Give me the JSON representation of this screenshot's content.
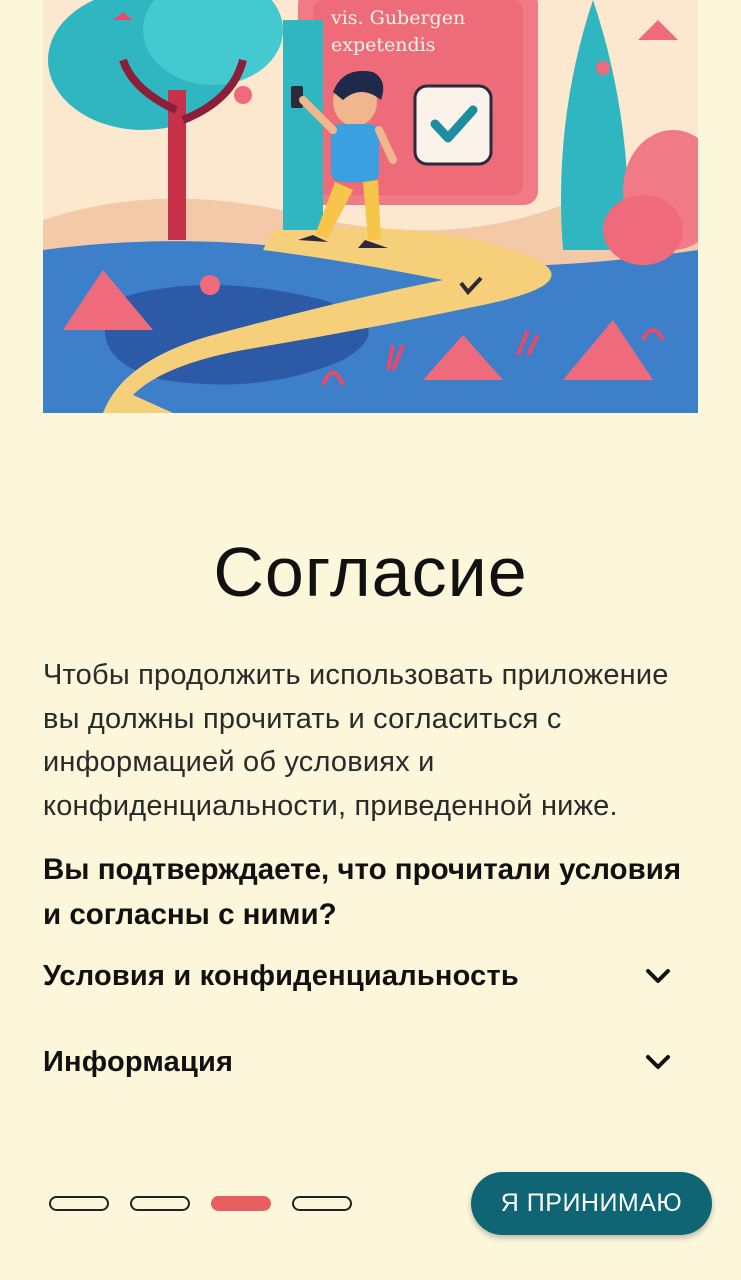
{
  "hero": {
    "sign_line1": "vis. Gubergen",
    "sign_line2": "expetendis"
  },
  "title": "Согласие",
  "description": "Чтобы продолжить использовать приложение вы должны прочитать и согласиться с информацией об условиях и конфиденциальности, приведенной ниже.",
  "question": "Вы подтверждаете, что прочитали условия и согласны с ними?",
  "accordion": [
    {
      "label": "Условия и конфиденциальность",
      "icon": "chevron-down-icon"
    },
    {
      "label": "Информация",
      "icon": "chevron-down-icon"
    }
  ],
  "pager": {
    "total": 4,
    "active_index": 2
  },
  "accept_button": "Я ПРИНИМАЮ",
  "colors": {
    "background": "#fcf6db",
    "accent": "#0f6574",
    "active_dot": "#e85f5f"
  }
}
